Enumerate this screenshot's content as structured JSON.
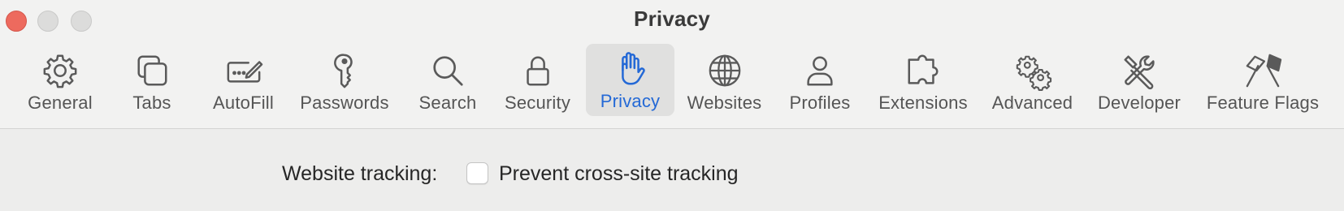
{
  "window": {
    "title": "Privacy"
  },
  "toolbar": {
    "selected": "Privacy",
    "accent_color": "#2469d6",
    "tabs": [
      {
        "label": "General",
        "icon": "gear-icon"
      },
      {
        "label": "Tabs",
        "icon": "tabs-icon"
      },
      {
        "label": "AutoFill",
        "icon": "autofill-icon"
      },
      {
        "label": "Passwords",
        "icon": "key-icon"
      },
      {
        "label": "Search",
        "icon": "search-icon"
      },
      {
        "label": "Security",
        "icon": "lock-icon"
      },
      {
        "label": "Privacy",
        "icon": "hand-icon"
      },
      {
        "label": "Websites",
        "icon": "globe-icon"
      },
      {
        "label": "Profiles",
        "icon": "person-icon"
      },
      {
        "label": "Extensions",
        "icon": "puzzle-icon"
      },
      {
        "label": "Advanced",
        "icon": "gears-icon"
      },
      {
        "label": "Developer",
        "icon": "tools-icon"
      },
      {
        "label": "Feature Flags",
        "icon": "flags-icon"
      }
    ]
  },
  "privacy": {
    "website_tracking_label": "Website tracking:",
    "prevent_tracking_label": "Prevent cross-site tracking",
    "prevent_tracking_checked": false
  }
}
